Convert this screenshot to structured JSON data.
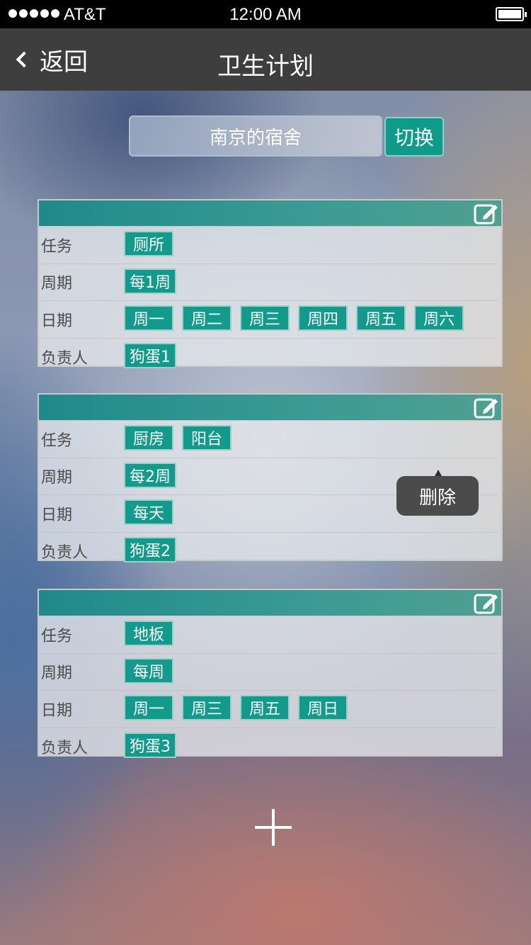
{
  "status_bar": {
    "carrier": "AT&T",
    "time": "12:00 AM"
  },
  "nav": {
    "back_label": "返回",
    "title": "卫生计划"
  },
  "dorm": {
    "name": "南京的宿舍",
    "switch_label": "切换"
  },
  "labels": {
    "task": "任务",
    "cycle": "周期",
    "date": "日期",
    "owner": "负责人"
  },
  "plans": [
    {
      "tasks": [
        "厕所"
      ],
      "cycle": "每1周",
      "dates": [
        "周一",
        "周二",
        "周三",
        "周四",
        "周五",
        "周六"
      ],
      "owner": "狗蛋1"
    },
    {
      "tasks": [
        "厨房",
        "阳台"
      ],
      "cycle": "每2周",
      "dates": [
        "每天"
      ],
      "owner": "狗蛋2"
    },
    {
      "tasks": [
        "地板"
      ],
      "cycle": "每周",
      "dates": [
        "周一",
        "周三",
        "周五",
        "周日"
      ],
      "owner": "狗蛋3"
    }
  ],
  "delete_popup": {
    "label": "删除"
  },
  "colors": {
    "accent": "#129a8c",
    "nav_bg": "#3e3e3e",
    "header_teal": "#1f8a8a"
  },
  "icons": {
    "edit": "edit-icon",
    "back": "chevron-left-icon",
    "add": "plus-icon"
  }
}
